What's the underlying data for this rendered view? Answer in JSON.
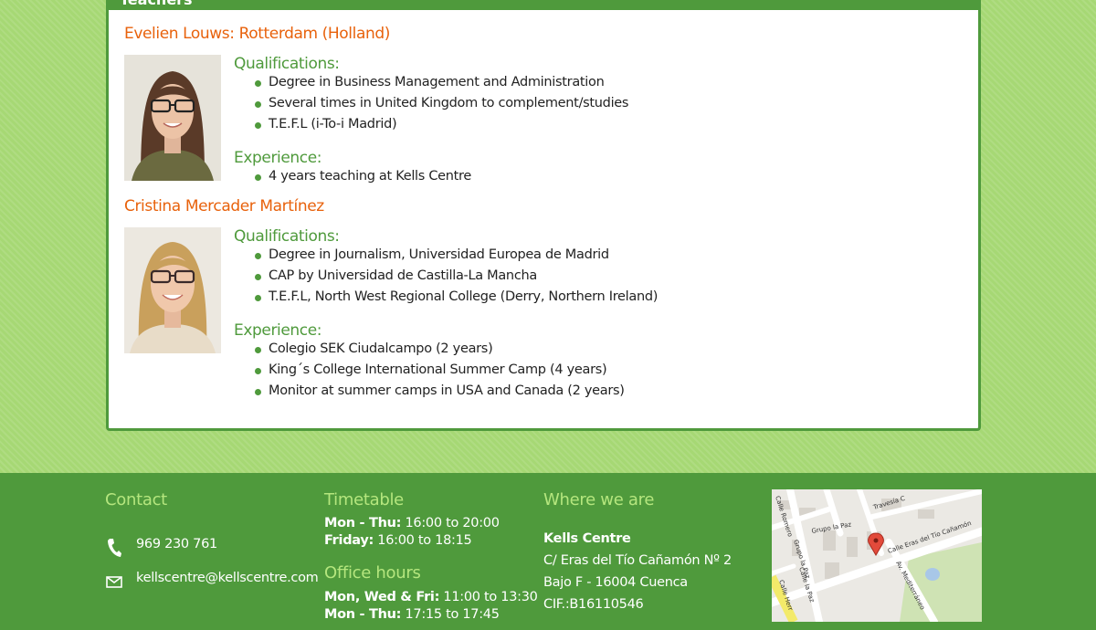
{
  "section": {
    "title": "Teachers"
  },
  "teachers": [
    {
      "name": "Evelien Louws: Rotterdam (Holland)",
      "qualifications_label": "Qualifications:",
      "qualifications": [
        "Degree in Business Management and Administration",
        "Several times in United Kingdom to complement/studies",
        "T.E.F.L (i-To-i Madrid)"
      ],
      "experience_label": "Experience:",
      "experience": [
        "4 years teaching at Kells Centre"
      ]
    },
    {
      "name": "Cristina Mercader Martínez",
      "qualifications_label": "Qualifications:",
      "qualifications": [
        "Degree in Journalism, Universidad Europea de Madrid",
        "CAP by Universidad de Castilla-La Mancha",
        "T.E.F.L, North West Regional College (Derry, Northern Ireland)"
      ],
      "experience_label": "Experience:",
      "experience": [
        "Colegio SEK Ciudalcampo (2 years)",
        "King´s College International Summer Camp (4 years)",
        "Monitor at summer camps in USA and Canada (2 years)"
      ]
    }
  ],
  "footer": {
    "contact": {
      "title": "Contact",
      "phone": "969 230 761",
      "email": "kellscentre@kellscentre.com",
      "phone_icon": "phone-icon",
      "email_icon": "envelope-icon"
    },
    "timetable": {
      "title": "Timetable",
      "rows": [
        {
          "days": "Mon - Thu:",
          "hours": "16:00 to 20:00"
        },
        {
          "days": "Friday:",
          "hours": "16:00 to 18:15"
        }
      ]
    },
    "office_hours": {
      "title": "Office hours",
      "rows": [
        {
          "days": "Mon, Wed & Fri:",
          "hours": "11:00 to 13:30"
        },
        {
          "days": "Mon - Thu:",
          "hours": "17:15 to 17:45"
        }
      ]
    },
    "where": {
      "title": "Where we are",
      "name": "Kells Centre",
      "address1": "C/ Eras del Tío Cañamón Nº 2",
      "address2": "Bajo F - 16004 Cuenca",
      "cif": "CIF.:B16110546"
    },
    "map": {
      "labels": [
        "Travesía C",
        "Calle Eras del Tío Cañamón",
        "Grupo la Paz",
        "Calle Romero",
        "Grupo la Paz",
        "Calle la Paz",
        "Av. Mediterráneo",
        "Calle Herr"
      ]
    }
  },
  "colors": {
    "accent_green": "#4f9a3c",
    "name_orange": "#e8620c",
    "footer_heading": "#b5e67e",
    "page_background": "#a6d874"
  }
}
